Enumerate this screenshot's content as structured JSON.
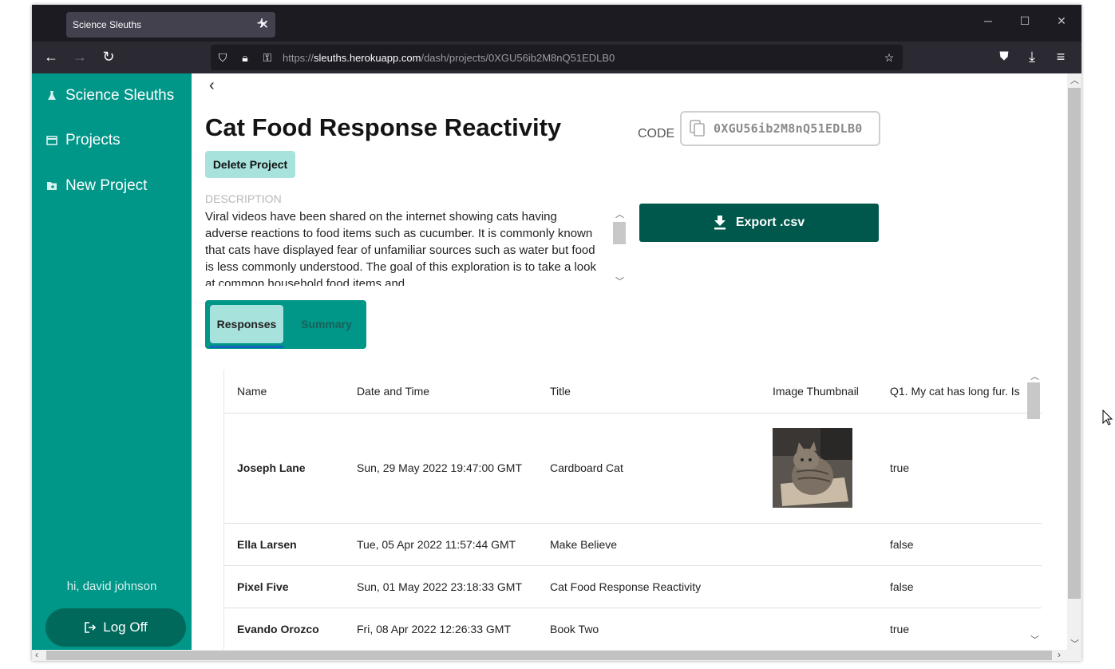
{
  "browser": {
    "tab_title": "Science Sleuths",
    "url_prefix": "https://",
    "url_host": "sleuths.herokuapp.com",
    "url_path": "/dash/projects/0XGU56ib2M8nQ51EDLB0"
  },
  "sidebar": {
    "items": [
      {
        "label": "Science Sleuths",
        "icon": "flask-icon"
      },
      {
        "label": "Projects",
        "icon": "card-icon"
      },
      {
        "label": "New Project",
        "icon": "folder-plus-icon"
      }
    ],
    "greeting": "hi, david johnson",
    "logoff_label": "Log Off"
  },
  "project": {
    "title": "Cat Food Response Reactivity",
    "code_label": "CODE",
    "code": "0XGU56ib2M8nQ51EDLB0",
    "delete_label": "Delete Project",
    "description_label": "DESCRIPTION",
    "description": "Viral videos have been shared on the internet showing cats having adverse reactions to food items such as cucumber. It is commonly known that cats have displayed fear of unfamiliar sources such as water but food is less commonly understood. The goal of this exploration is to take a look at common household food items and",
    "export_label": "Export .csv"
  },
  "tabs": {
    "responses": "Responses",
    "summary": "Summary"
  },
  "table": {
    "headers": [
      "Name",
      "Date and Time",
      "Title",
      "Image Thumbnail",
      "Q1. My cat has long fur. Is"
    ],
    "rows": [
      {
        "name": "Joseph Lane",
        "date": "Sun, 29 May 2022 19:47:00 GMT",
        "title": "Cardboard Cat",
        "q1": "true"
      },
      {
        "name": "Ella Larsen",
        "date": "Tue, 05 Apr 2022 11:57:44 GMT",
        "title": "Make Believe",
        "q1": "false"
      },
      {
        "name": "Pixel Five",
        "date": "Sun, 01 May 2022 23:18:33 GMT",
        "title": "Cat Food Response Reactivity",
        "q1": "false"
      },
      {
        "name": "Evando Orozco",
        "date": "Fri, 08 Apr 2022 12:26:33 GMT",
        "title": "Book Two",
        "q1": "true"
      }
    ]
  },
  "colors": {
    "sidebar": "#009688",
    "accent_dark": "#00574b",
    "chip": "#a7e2dc"
  }
}
